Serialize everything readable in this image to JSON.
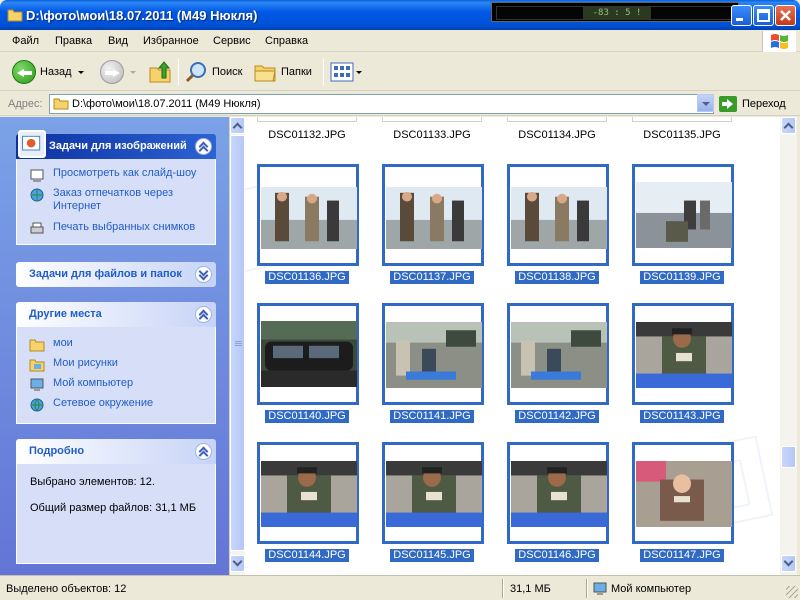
{
  "window": {
    "title": "D:\\фото\\мои\\18.07.2011 (М49 Нюкля)",
    "tray_text": "-83 : 5 !"
  },
  "menu": [
    "Файл",
    "Правка",
    "Вид",
    "Избранное",
    "Сервис",
    "Справка"
  ],
  "toolbar": {
    "back_label": "Назад",
    "search_label": "Поиск",
    "folders_label": "Папки"
  },
  "address": {
    "label": "Адрес:",
    "value": "D:\\фото\\мои\\18.07.2011 (М49 Нюкля)",
    "go_label": "Переход"
  },
  "taskpane": {
    "image_tasks": {
      "title": "Задачи для изображений",
      "items": [
        {
          "label": "Просмотреть как слайд-шоу",
          "icon": "slideshow-icon"
        },
        {
          "label": "Заказ отпечатков через Интернет",
          "icon": "print-order-icon"
        },
        {
          "label": "Печать выбранных снимков",
          "icon": "printer-icon"
        }
      ]
    },
    "file_tasks": {
      "title": "Задачи для файлов и папок"
    },
    "other_places": {
      "title": "Другие места",
      "items": [
        {
          "label": "мои",
          "icon": "folder-icon"
        },
        {
          "label": "Мои рисунки",
          "icon": "my-pictures-icon"
        },
        {
          "label": "Мой компьютер",
          "icon": "my-computer-icon"
        },
        {
          "label": "Сетевое окружение",
          "icon": "network-icon"
        }
      ]
    },
    "details": {
      "title": "Подробно",
      "selected": "Выбрано элементов: 12.",
      "total_size": "Общий размер файлов: 31,1 МБ"
    }
  },
  "files_top_row": [
    "DSC01132.JPG",
    "DSC01133.JPG",
    "DSC01134.JPG",
    "DSC01135.JPG"
  ],
  "files": [
    {
      "name": "DSC01136.JPG",
      "selected": true,
      "scene": "beach-people"
    },
    {
      "name": "DSC01137.JPG",
      "selected": true,
      "scene": "beach-people"
    },
    {
      "name": "DSC01138.JPG",
      "selected": true,
      "scene": "beach-people"
    },
    {
      "name": "DSC01139.JPG",
      "selected": true,
      "scene": "shore-sitting"
    },
    {
      "name": "DSC01140.JPG",
      "selected": true,
      "scene": "car"
    },
    {
      "name": "DSC01141.JPG",
      "selected": true,
      "scene": "picnic"
    },
    {
      "name": "DSC01142.JPG",
      "selected": true,
      "scene": "picnic"
    },
    {
      "name": "DSC01143.JPG",
      "selected": true,
      "scene": "man-eating"
    },
    {
      "name": "DSC01144.JPG",
      "selected": true,
      "scene": "man-eating"
    },
    {
      "name": "DSC01145.JPG",
      "selected": true,
      "scene": "man-eating"
    },
    {
      "name": "DSC01146.JPG",
      "selected": true,
      "scene": "man-eating"
    },
    {
      "name": "DSC01147.JPG",
      "selected": true,
      "scene": "woman-eating"
    }
  ],
  "status": {
    "selected_objects": "Выделено объектов: 12",
    "size": "31,1 МБ",
    "location": "Мой компьютер"
  },
  "colors": {
    "selection": "#316ac5",
    "taskpane_bg": "#6f8ddd",
    "titlebar": "#0058e6"
  }
}
